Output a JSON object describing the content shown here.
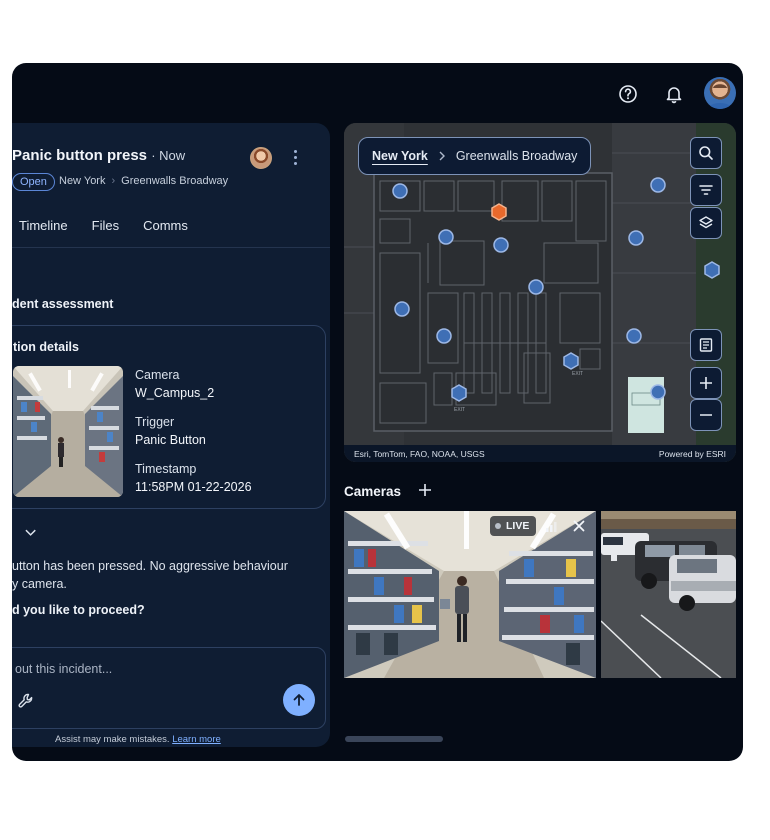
{
  "incident": {
    "title": "Panic button press",
    "time": "· Now",
    "status": "Open",
    "breadcrumb": [
      "New York",
      "Greenwalls Broadway"
    ]
  },
  "tabs": [
    "Timeline",
    "Files",
    "Comms"
  ],
  "assessment": {
    "heading": "dent assessment",
    "card_title": "tion details",
    "camera_label": "Camera",
    "camera_value": "W_Campus_2",
    "trigger_label": "Trigger",
    "trigger_value": "Panic Button",
    "timestamp_label": "Timestamp",
    "timestamp_value": "11:58PM 01-22-2026",
    "summary_line1": "utton has been pressed. No aggressive behaviour",
    "summary_line2": "y camera.",
    "question": "d you like to proceed?"
  },
  "composer": {
    "placeholder": "out this incident...",
    "disclaimer": "Assist may make mistakes.",
    "learn_more": "Learn more"
  },
  "map": {
    "crumb_city": "New York",
    "crumb_site": "Greenwalls Broadway",
    "attribution": "Esri, TomTom, FAO, NOAA, USGS",
    "powered": "Powered by ESRI",
    "labels": [
      "EXIT",
      "EXIT"
    ]
  },
  "cameras": {
    "title": "Cameras",
    "live_label": "LIVE"
  },
  "colors": {
    "app_bg": "#050b16",
    "panel_bg": "#0f1d33",
    "accent": "#7fb0ff",
    "map_marker": "#3f6fb5",
    "alert_marker": "#e8692c"
  }
}
